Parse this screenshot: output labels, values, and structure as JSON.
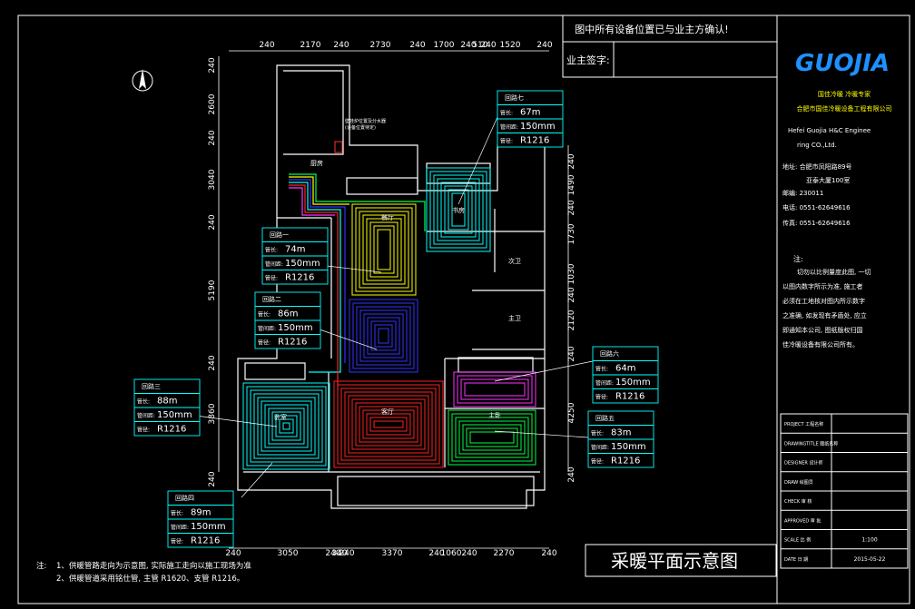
{
  "header": {
    "confirm_note": "图中所有设备位置已与业主方确认!",
    "owner_sign_label": "业主签字:"
  },
  "company": {
    "logo_text": "GUOJIA",
    "slogan": "国佳冷暖 冷暖专家",
    "name_cn": "合肥市国佳冷暖设备工程有限公司",
    "name_en_line1": "Hefei Guojia H&C Enginee",
    "name_en_line2": "ring CO.,Ltd.",
    "address_line1": "地址: 合肥市凤阳路89号",
    "address_line2": "亚泰大厦100室",
    "postcode": "邮编: 230011",
    "phone": "电话: 0551-62649616",
    "fax": "传真: 0551-62649616"
  },
  "notice": {
    "title": "注:",
    "lines": [
      "切勿以比例量度此图, 一切",
      "以图内数字所示为准, 施工者",
      "必须在工地核对图内所示数字",
      "之准确, 如发现有矛盾处, 应立",
      "即通知本公司, 图纸版权归国",
      "佳冷暖设备有限公司所有。"
    ]
  },
  "title_block": {
    "rows": [
      {
        "label": "PROJECT 工程名称",
        "value": ""
      },
      {
        "label": "DRAWINGTITLE 图纸名称",
        "value": ""
      },
      {
        "label": "DESIGNER 设计师",
        "value": ""
      },
      {
        "label": "DRAW 绘图员",
        "value": ""
      },
      {
        "label": "CHECK 审 核",
        "value": ""
      },
      {
        "label": "APPROVED 审 批",
        "value": ""
      },
      {
        "label": "SCALE 比 例",
        "value": "1:100"
      },
      {
        "label": "DATE 日 期",
        "value": "2015-05-22"
      }
    ]
  },
  "drawing_title": "采暖平面示意图",
  "footnotes": {
    "prefix": "注:",
    "line1": "1、供暖管路走向为示意图, 实际施工走向以施工现场为准",
    "line2": "2、供暖管道采用铭仕管, 主管 R1620、支管 R1216。"
  },
  "dimensions": {
    "top": [
      "240",
      "2170",
      "240",
      "2730",
      "240",
      "1700",
      "240",
      "510",
      "240",
      "1520",
      "240"
    ],
    "bottom": [
      "240",
      "3050",
      "240",
      "340",
      "240",
      "3370",
      "240",
      "1060",
      "240",
      "2270",
      "240"
    ],
    "left": [
      "240",
      "2600",
      "240",
      "3040",
      "240",
      "5190",
      "240",
      "3860",
      "240"
    ],
    "right": [
      "240",
      "1490",
      "240",
      "1730",
      "1030",
      "240",
      "2120",
      "240",
      "4250",
      "240"
    ]
  },
  "rooms": {
    "kitchen": "厨房",
    "dining": "餐厅",
    "study": "书房",
    "secondary_bath": "次卫",
    "main_bath": "主卫",
    "living": "客厅",
    "bedroom": "卧室",
    "master_bedroom": "主卧",
    "boiler_note_1": "壁挂炉位置及分水器",
    "boiler_note_2": "(设备位置待定)"
  },
  "loops": [
    {
      "title": "回路一",
      "length_label": "管长:",
      "length": "74m",
      "spacing_label": "管间距:",
      "spacing": "150mm",
      "pipe_label": "管径:",
      "pipe": "R1216",
      "color": "#ffff00"
    },
    {
      "title": "回路二",
      "length_label": "管长:",
      "length": "86m",
      "spacing_label": "管间距:",
      "spacing": "150mm",
      "pipe_label": "管径:",
      "pipe": "R1216",
      "color": "#3333ff"
    },
    {
      "title": "回路三",
      "length_label": "管长:",
      "length": "88m",
      "spacing_label": "管间距:",
      "spacing": "150mm",
      "pipe_label": "管径:",
      "pipe": "R1216",
      "color": "#00ffff"
    },
    {
      "title": "回路四",
      "length_label": "管长:",
      "length": "89m",
      "spacing_label": "管间距:",
      "spacing": "150mm",
      "pipe_label": "管径:",
      "pipe": "R1216",
      "color": "#ff2222"
    },
    {
      "title": "回路五",
      "length_label": "管长:",
      "length": "83m",
      "spacing_label": "管间距:",
      "spacing": "150mm",
      "pipe_label": "管径:",
      "pipe": "R1216",
      "color": "#00ff44"
    },
    {
      "title": "回路六",
      "length_label": "管长:",
      "length": "64m",
      "spacing_label": "管间距:",
      "spacing": "150mm",
      "pipe_label": "管径:",
      "pipe": "R1216",
      "color": "#ff33ff"
    },
    {
      "title": "回路七",
      "length_label": "管长:",
      "length": "67m",
      "spacing_label": "管间距:",
      "spacing": "150mm",
      "pipe_label": "管径:",
      "pipe": "R1216",
      "color": "#00ffff"
    }
  ],
  "colors": {
    "background": "#000000",
    "frame": "#ffffff",
    "annotation": "#00ffff",
    "logo": "#1e90ff"
  }
}
